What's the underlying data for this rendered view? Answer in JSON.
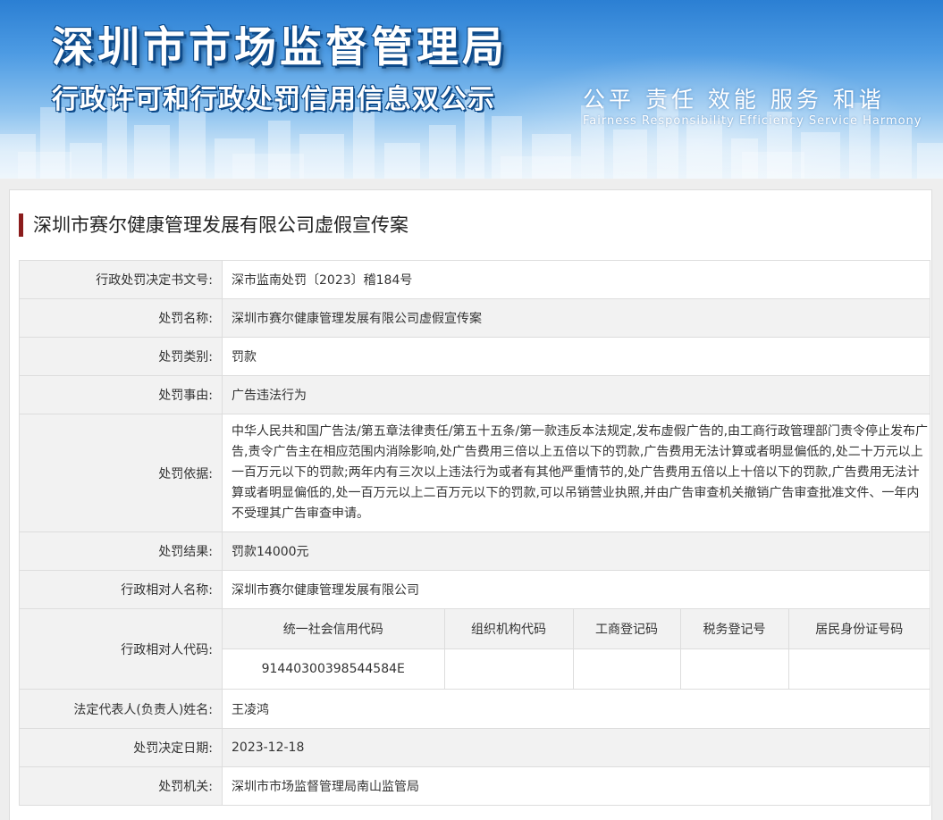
{
  "banner": {
    "title": "深圳市市场监督管理局",
    "subtitle": "行政许可和行政处罚信用信息双公示",
    "slogan_cn": "公平 责任 效能 服务 和谐",
    "slogan_en": "Fairness Responsibility Efficiency Service Harmony"
  },
  "page_title": "深圳市赛尔健康管理发展有限公司虚假宣传案",
  "fields": {
    "decision_no": {
      "label": "行政处罚决定书文号:",
      "value": "深市监南处罚〔2023〕稽184号"
    },
    "penalty_name": {
      "label": "处罚名称:",
      "value": "深圳市赛尔健康管理发展有限公司虚假宣传案"
    },
    "penalty_type": {
      "label": "处罚类别:",
      "value": "罚款"
    },
    "penalty_reason": {
      "label": "处罚事由:",
      "value": "广告违法行为"
    },
    "penalty_basis": {
      "label": "处罚依据:",
      "value": "中华人民共和国广告法/第五章法律责任/第五十五条/第一款违反本法规定,发布虚假广告的,由工商行政管理部门责令停止发布广告,责令广告主在相应范围内消除影响,处广告费用三倍以上五倍以下的罚款,广告费用无法计算或者明显偏低的,处二十万元以上一百万元以下的罚款;两年内有三次以上违法行为或者有其他严重情节的,处广告费用五倍以上十倍以下的罚款,广告费用无法计算或者明显偏低的,处一百万元以上二百万元以下的罚款,可以吊销营业执照,并由广告审查机关撤销广告审查批准文件、一年内不受理其广告审查申请。"
    },
    "penalty_result": {
      "label": "处罚结果:",
      "value": "罚款14000元"
    },
    "party_name": {
      "label": "行政相对人名称:",
      "value": "深圳市赛尔健康管理发展有限公司"
    },
    "party_code": {
      "label": "行政相对人代码:",
      "headers": [
        "统一社会信用代码",
        "组织机构代码",
        "工商登记码",
        "税务登记号",
        "居民身份证号码"
      ],
      "values": [
        "91440300398544584E",
        "",
        "",
        "",
        ""
      ]
    },
    "legal_rep": {
      "label": "法定代表人(负责人)姓名:",
      "value": "王凌鸿"
    },
    "decision_date": {
      "label": "处罚决定日期:",
      "value": "2023-12-18"
    },
    "authority": {
      "label": "处罚机关:",
      "value": "深圳市市场监督管理局南山监管局"
    }
  },
  "colors": {
    "title_accent": "#8b1c1c",
    "label_bg": "#f2f2f2",
    "border": "#dddddd",
    "banner_blue": "#2b7fd3"
  }
}
